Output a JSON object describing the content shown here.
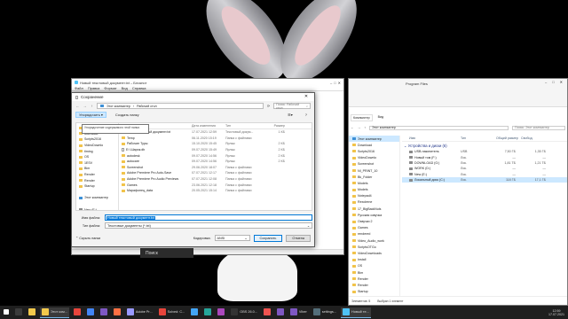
{
  "notepad": {
    "title": "Новый текстовый документ.txt – Блокнот",
    "menu": [
      "Файл",
      "Правка",
      "Формат",
      "Вид",
      "Справка"
    ]
  },
  "dialog": {
    "title": "Сохранение",
    "close": "✕",
    "address": [
      "Этот компьютер",
      "Рабочий стол"
    ],
    "search_placeholder": "Поиск: Рабочий стол",
    "toolbar": {
      "organize": "Упорядочить ▾",
      "new_folder": "Создать папку"
    },
    "tooltip": "Упорядочение содержимого этой папки.",
    "tree": [
      {
        "label": "Desktop",
        "icon": "folder"
      },
      {
        "label": "download",
        "icon": "folder"
      },
      {
        "label": "Scripts2016",
        "icon": "folder"
      },
      {
        "label": "VideoDownlo",
        "icon": "folder"
      },
      {
        "label": "timing",
        "icon": "folder"
      },
      {
        "label": "OS",
        "icon": "folder"
      },
      {
        "label": "1ESV",
        "icon": "folder"
      },
      {
        "label": "Bim",
        "icon": "folder"
      },
      {
        "label": "Render",
        "icon": "folder"
      },
      {
        "label": "Render",
        "icon": "folder"
      },
      {
        "label": "Startup",
        "icon": "folder"
      },
      {
        "label": "",
        "icon": ""
      },
      {
        "label": "Этот компьютер",
        "icon": "pc"
      },
      {
        "label": "",
        "icon": ""
      },
      {
        "label": "New (E:)",
        "icon": "drive"
      },
      {
        "label": "",
        "icon": ""
      },
      {
        "label": "Сеть",
        "icon": "pc"
      }
    ],
    "columns": {
      "name": "Имя",
      "date": "Дата изменения",
      "type": "Тип",
      "size": "Размер"
    },
    "files": [
      {
        "name": "Новый текстовый документ.txt",
        "date": "17.07.2021 12:59",
        "type": "Текстовый докум...",
        "size": "1 КБ",
        "icon": "file"
      },
      {
        "name": "Temp",
        "date": "06.11.2020 15:19",
        "type": "Папка с файлами",
        "size": "",
        "icon": "folder"
      },
      {
        "name": "Рабочие Туры",
        "date": "15.10.2020 15:45",
        "type": "Ярлык",
        "size": "2 КБ",
        "icon": "folder"
      },
      {
        "name": "E:\\ Шарик.db",
        "date": "09.07.2020 15:49",
        "type": "Ярлык",
        "size": "2 КБ",
        "icon": "file"
      },
      {
        "name": "autodesk",
        "date": "09.07.2020 14:56",
        "type": "Ярлык",
        "size": "2 КБ",
        "icon": "folder"
      },
      {
        "name": "autocare",
        "date": "09.07.2020 14:56",
        "type": "Ярлык",
        "size": "2 КБ",
        "icon": "folder"
      },
      {
        "name": "Screenshot",
        "date": "29.06.2020 18:07",
        "type": "Папка с файлами",
        "size": "",
        "icon": "folder"
      },
      {
        "name": "Adobe Premiere Pro Auto-Save",
        "date": "07.07.2021 12:17",
        "type": "Папка с файлами",
        "size": "",
        "icon": "folder"
      },
      {
        "name": "Adobe Premiere Pro Audio Previews",
        "date": "07.07.2021 12:08",
        "type": "Папка с файлами",
        "size": "",
        "icon": "folder"
      },
      {
        "name": "Games",
        "date": "23.06.2021 12:18",
        "type": "Папка с файлами",
        "size": "",
        "icon": "folder"
      },
      {
        "name": "Марафонец_data",
        "date": "20.05.2021 15:14",
        "type": "Папка с файлами",
        "size": "",
        "icon": "folder"
      }
    ],
    "filename_label": "Имя файла:",
    "filename_value": "Новый текстовый документ.txt",
    "filetype_label": "Тип файла:",
    "filetype_value": "Текстовые документы (*.txt)",
    "hide_folders": "⌃ Скрыть папки",
    "encoding_label": "Кодировка:",
    "encoding_value": "ANSI",
    "save": "Сохранить",
    "cancel": "Отмена"
  },
  "search_pill": "Поиск",
  "explorer": {
    "path": "Program Files",
    "caption": [
      "–",
      "□",
      "✕"
    ],
    "ribbon": [
      "Компьютер",
      "Вид"
    ],
    "address": "Этот компьютер",
    "search": "Поиск: Этот компьютер",
    "side": [
      {
        "label": "Этот компьютер",
        "icon": "pc",
        "selected": true
      },
      {
        "label": "Download",
        "icon": "folder"
      },
      {
        "label": "Scripts2016",
        "icon": "folder"
      },
      {
        "label": "VideoDownlo",
        "icon": "folder"
      },
      {
        "label": "Screenshot",
        "icon": "folder"
      },
      {
        "label": "NI_PRINT_10",
        "icon": "folder"
      },
      {
        "label": "Bk_Folder",
        "icon": "folder"
      },
      {
        "label": "Models",
        "icon": "folder"
      },
      {
        "label": "Models",
        "icon": "folder"
      },
      {
        "label": "Notepad4",
        "icon": "folder"
      },
      {
        "label": "Rexolerne",
        "icon": "folder"
      },
      {
        "label": "17_BigBackNuls",
        "icon": "folder"
      },
      {
        "label": "Русская озвучка",
        "icon": "folder"
      },
      {
        "label": "Озвучки 2",
        "icon": "folder"
      },
      {
        "label": "Games",
        "icon": "folder"
      },
      {
        "label": "rendered",
        "icon": "folder"
      },
      {
        "label": "Video_Audio_work",
        "icon": "folder"
      },
      {
        "label": "ScriptsOTGo",
        "icon": "folder"
      },
      {
        "label": "VideoDownloads",
        "icon": "folder"
      },
      {
        "label": "Install",
        "icon": "folder"
      },
      {
        "label": "OS",
        "icon": "folder"
      },
      {
        "label": "Bim",
        "icon": "folder"
      },
      {
        "label": "Render",
        "icon": "folder"
      },
      {
        "label": "Render",
        "icon": "folder"
      },
      {
        "label": "Startup",
        "icon": "folder"
      },
      {
        "label": "",
        "icon": ""
      },
      {
        "label": "Этот компьютер",
        "icon": "pc"
      },
      {
        "label": "",
        "icon": ""
      },
      {
        "label": "New (E:)",
        "icon": "drive"
      },
      {
        "label": "",
        "icon": ""
      },
      {
        "label": "Сеть",
        "icon": "pc"
      }
    ],
    "columns": {
      "name": "Имя",
      "type": "Тип",
      "total": "Общий размер",
      "free": "Свобод."
    },
    "group": "Устройства и диски (6)",
    "drives": [
      {
        "name": "USB-накопитель",
        "type": "USB",
        "total": "7,50 ГБ",
        "free": "1,35 ГБ"
      },
      {
        "name": "Новый том (F:)",
        "type": "Лок.",
        "total": "—",
        "free": "—"
      },
      {
        "name": "DOWNLOAD (G:)",
        "type": "Лок.",
        "total": "1,81 ТБ",
        "free": "1,21 ТБ"
      },
      {
        "name": "WORK (D:)",
        "type": "Лок.",
        "total": "—",
        "free": "—"
      },
      {
        "name": "New (E:)",
        "type": "Лок.",
        "total": "—",
        "free": "—"
      },
      {
        "name": "Локальный диск (C:)",
        "type": "Лок.",
        "total": "118 ГБ",
        "free": "17,1 ГБ",
        "selected": true
      }
    ],
    "status": [
      "Элементов: 5",
      "Выбран 1 элемент"
    ]
  },
  "taskbar": {
    "items": [
      {
        "label": "",
        "color": "#3b3b3b",
        "active": false
      },
      {
        "label": "",
        "color": "#f2c94c",
        "active": false
      },
      {
        "label": "Этот ком...",
        "color": "#f2c94c",
        "active": true
      },
      {
        "label": "",
        "color": "#e8453c",
        "active": false
      },
      {
        "label": "",
        "color": "#4285f4",
        "active": false
      },
      {
        "label": "",
        "color": "#7e57c2",
        "active": false
      },
      {
        "label": "",
        "color": "#ff7043",
        "active": false
      },
      {
        "label": "Adobe Pr...",
        "color": "#9999ff",
        "active": false
      },
      {
        "label": "Solved: C...",
        "color": "#e8453c",
        "active": false
      },
      {
        "label": "",
        "color": "#42a5f5",
        "active": false
      },
      {
        "label": "",
        "color": "#26a69a",
        "active": false
      },
      {
        "label": "",
        "color": "#ab47bc",
        "active": false
      },
      {
        "label": "OBS 26.0...",
        "color": "#333333",
        "active": false
      },
      {
        "label": "",
        "color": "#ef5350",
        "active": false
      },
      {
        "label": "",
        "color": "#7e57c2",
        "active": false
      },
      {
        "label": "Viber",
        "color": "#7e57c2",
        "active": false
      },
      {
        "label": "settings...",
        "color": "#546e7a",
        "active": false
      },
      {
        "label": "Новый те...",
        "color": "#4fc3f7",
        "active": true
      }
    ],
    "time": "12:59",
    "date": "17.07.2021"
  }
}
